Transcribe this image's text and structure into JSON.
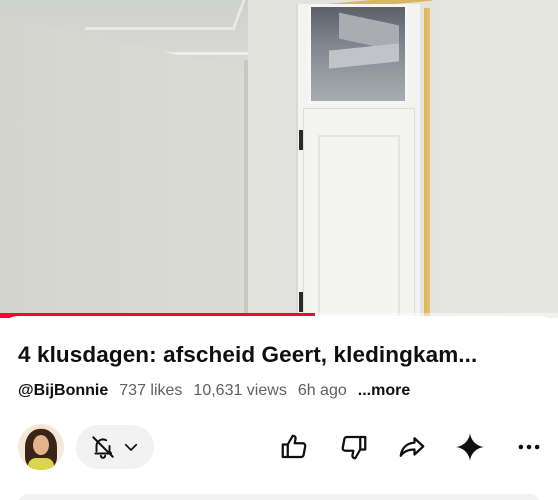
{
  "video": {
    "progress_fraction": 0.565
  },
  "details": {
    "title": "4 klusdagen: afscheid Geert, kledingkam...",
    "channel": "@BijBonnie",
    "likes": "737 likes",
    "views": "10,631 views",
    "age": "6h ago",
    "more_label": "...more"
  },
  "actions": {
    "icons": [
      "avatar",
      "bell-off-icon",
      "chevron-down-icon",
      "thumbs-up-icon",
      "thumbs-down-icon",
      "share-icon",
      "sparkle-icon",
      "more-icon"
    ]
  }
}
